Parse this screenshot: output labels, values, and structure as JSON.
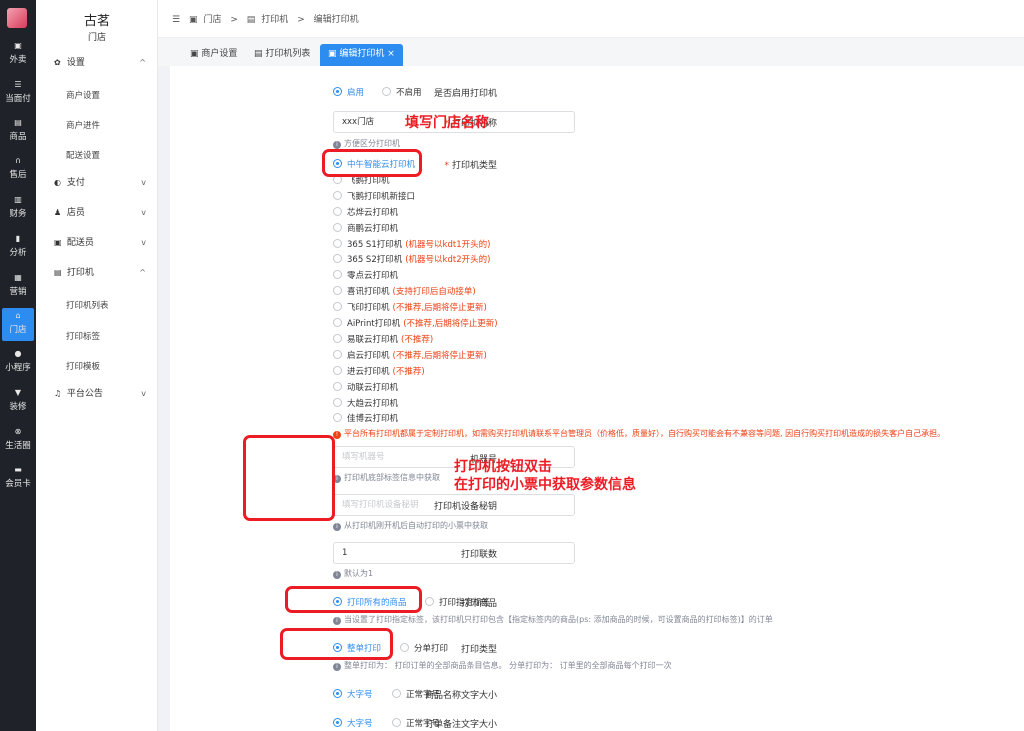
{
  "rail": {
    "items": [
      {
        "label": "外卖",
        "icon": "bag-icon"
      },
      {
        "label": "当面付",
        "icon": "list-icon"
      },
      {
        "label": "商品",
        "icon": "gift-icon"
      },
      {
        "label": "售后",
        "icon": "headset-icon"
      },
      {
        "label": "财务",
        "icon": "finance-icon"
      },
      {
        "label": "分析",
        "icon": "chart-icon"
      },
      {
        "label": "营销",
        "icon": "present-icon"
      },
      {
        "label": "门店",
        "icon": "store-icon"
      },
      {
        "label": "小程序",
        "icon": "chat-icon"
      },
      {
        "label": "装修",
        "icon": "shirt-icon"
      },
      {
        "label": "生活圈",
        "icon": "circle-icon"
      },
      {
        "label": "会员卡",
        "icon": "card-icon"
      }
    ]
  },
  "sidebar": {
    "brand": "古茗",
    "sub": "门店",
    "groups": [
      {
        "label": "设置"
      },
      {
        "label": "支付"
      },
      {
        "label": "店员"
      },
      {
        "label": "配送员"
      },
      {
        "label": "打印机"
      },
      {
        "label": "平台公告"
      }
    ],
    "settings_items": [
      "商户设置",
      "商户进件",
      "配送设置"
    ],
    "printer_items": [
      "打印机列表",
      "打印标签",
      "打印模板"
    ]
  },
  "breadcrumb": [
    "门店",
    "打印机",
    "编辑打印机"
  ],
  "tabs": [
    "商户设置",
    "打印机列表",
    "编辑打印机"
  ],
  "form": {
    "enable_label": "是否启用打印机",
    "enable_on": "启用",
    "enable_off": "不启用",
    "name_label": "打印机名称",
    "name_value": "xxx门店",
    "name_hint": "方便区分打印机",
    "type_label": "打印机类型",
    "printer_types": [
      {
        "name": "中午智能云打印机",
        "note": ""
      },
      {
        "name": "飞鹅打印机",
        "note": ""
      },
      {
        "name": "飞鹅打印机新接口",
        "note": ""
      },
      {
        "name": "芯烨云打印机",
        "note": ""
      },
      {
        "name": "商鹏云打印机",
        "note": ""
      },
      {
        "name": "365 S1打印机",
        "note": "(机器号以kdt1开头的)"
      },
      {
        "name": "365 S2打印机",
        "note": "(机器号以kdt2开头的)"
      },
      {
        "name": "零点云打印机",
        "note": ""
      },
      {
        "name": "喜讯打印机",
        "note": "(支持打印后自动接单)"
      },
      {
        "name": "飞印打印机",
        "note": "(不推荐,后期将停止更新)"
      },
      {
        "name": "AiPrint打印机",
        "note": "(不推荐,后期将停止更新)"
      },
      {
        "name": "易联云打印机",
        "note": "(不推荐)"
      },
      {
        "name": "启云打印机",
        "note": "(不推荐,后期将停止更新)"
      },
      {
        "name": "进云打印机",
        "note": "(不推荐)"
      },
      {
        "name": "动联云打印机",
        "note": ""
      },
      {
        "name": "大趋云打印机",
        "note": ""
      },
      {
        "name": "佳博云打印机",
        "note": ""
      }
    ],
    "type_warning": "平台所有打印机都属于定制打印机，如需购买打印机请联系平台管理员（价格低，质量好），自行购买可能会有不兼容等问题, 因自行购买打印机造成的损失客户自己承担。",
    "machine_label": "机器号",
    "machine_placeholder": "填写机器号",
    "machine_hint": "打印机底部标签信息中获取",
    "key_label": "打印机设备秘钥",
    "key_placeholder": "填写打印机设备秘钥",
    "key_hint": "从打印机刚开机后自动打印的小票中获取",
    "copies_label": "打印联数",
    "copies_value": "1",
    "copies_hint": "默认为1",
    "goods_label": "打印商品",
    "goods_all": "打印所有的商品",
    "goods_tag": "打印指定标签",
    "goods_hint": "当设置了打印指定标签，该打印机只打印包含【指定标签内的商品(ps: 添加商品的时候，可设置商品的打印标签)】的订单",
    "ptype_label": "打印类型",
    "ptype_whole": "整单打印",
    "ptype_split": "分单打印",
    "ptype_hint": "整单打印为： 打印订单的全部商品条目信息。 分单打印为： 订单里的全部商品每个打印一次",
    "goods_font_label": "商品名称文字大小",
    "remark_font_label": "订单备注文字大小",
    "font_big": "大字号",
    "font_normal": "正常字号"
  },
  "annotations": {
    "fill_name": "填写门店名称",
    "double_click": "打印机按钮双击",
    "get_params": "在打印的小票中获取参数信息"
  },
  "colors": {
    "accent": "#2d8cf0",
    "warning": "#ed4014",
    "annotation": "#ed1c24",
    "rail_bg": "#1f2329"
  }
}
